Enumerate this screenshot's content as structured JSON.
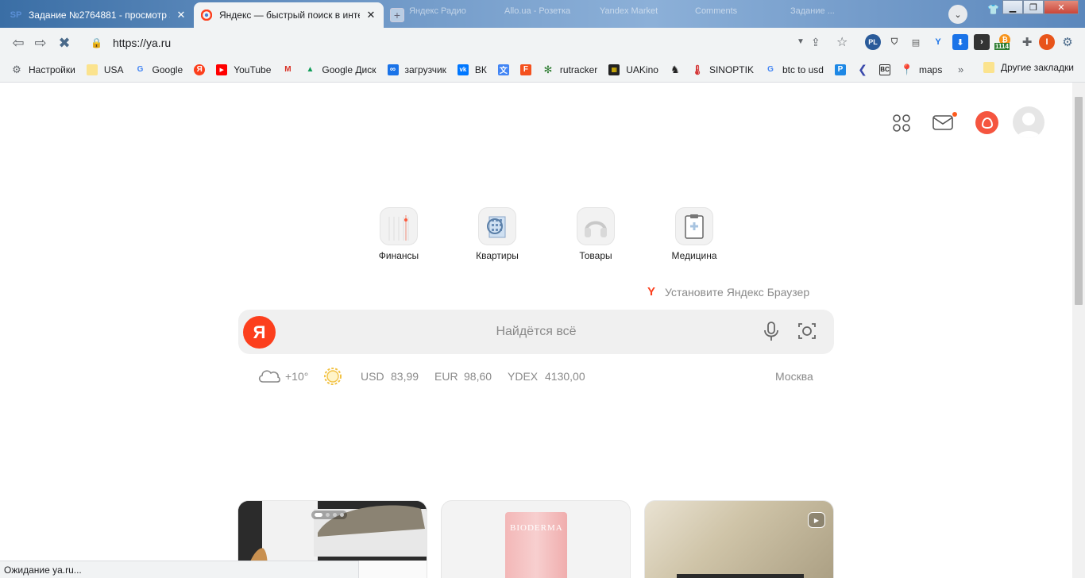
{
  "tabs": [
    {
      "title": "Задание №2764881 - просмотр з",
      "favicon": "SP"
    },
    {
      "title": "Яндекс — быстрый поиск в интер",
      "favicon": "ya"
    }
  ],
  "ghost_tabs": [
    "Яндекс Радио",
    "Allo.ua - Розетка",
    "Yandex Market",
    "Comments",
    "Задание ..."
  ],
  "toolbar": {
    "url": "https://ya.ru"
  },
  "extensions": {
    "badge_count": "1114"
  },
  "bookmarks": [
    {
      "label": "Настройки",
      "icon": "gear-icon"
    },
    {
      "label": "USA",
      "icon": "folder-icon"
    },
    {
      "label": "Google",
      "icon": "google-icon"
    },
    {
      "label": "",
      "icon": "yandex-icon"
    },
    {
      "label": "YouTube",
      "icon": "youtube-icon"
    },
    {
      "label": "",
      "icon": "gmail-icon"
    },
    {
      "label": "Google Диск",
      "icon": "drive-icon"
    },
    {
      "label": "загрузчик",
      "icon": "infinity-icon"
    },
    {
      "label": "ВК",
      "icon": "vk-icon"
    },
    {
      "label": "",
      "icon": "translate-icon"
    },
    {
      "label": "",
      "icon": "f-icon"
    },
    {
      "label": "rutracker",
      "icon": "rutracker-icon"
    },
    {
      "label": "UAKino",
      "icon": "film-icon"
    },
    {
      "label": "",
      "icon": "chess-icon"
    },
    {
      "label": "SINOPTIK",
      "icon": "thermometer-icon"
    },
    {
      "label": "btc to usd",
      "icon": "google-icon"
    },
    {
      "label": "",
      "icon": "p-icon"
    },
    {
      "label": "",
      "icon": "chevron-icon"
    },
    {
      "label": "",
      "icon": "bc-icon"
    },
    {
      "label": "maps",
      "icon": "maps-icon"
    }
  ],
  "bookmarks_more": "»",
  "bookmarks_other": "Другие закладки",
  "services": [
    {
      "label": "Финансы",
      "icon": "finance-icon"
    },
    {
      "label": "Квартиры",
      "icon": "apartments-icon"
    },
    {
      "label": "Товары",
      "icon": "headphones-icon"
    },
    {
      "label": "Медицина",
      "icon": "medicine-icon"
    }
  ],
  "install_browser": "Установите Яндекс Браузер",
  "search": {
    "logo": "Я",
    "placeholder": "Найдётся всё"
  },
  "weather": {
    "temp": "+10°"
  },
  "rates": [
    {
      "name": "USD",
      "value": "83,99"
    },
    {
      "name": "EUR",
      "value": "98,60"
    },
    {
      "name": "YDEX",
      "value": "4130,00"
    }
  ],
  "city": "Москва",
  "card2_brand": "BIODERMA",
  "status": "Ожидание ya.ru...",
  "colors": {
    "yandex_red": "#fc3f1d",
    "alice": "#f5553f"
  }
}
